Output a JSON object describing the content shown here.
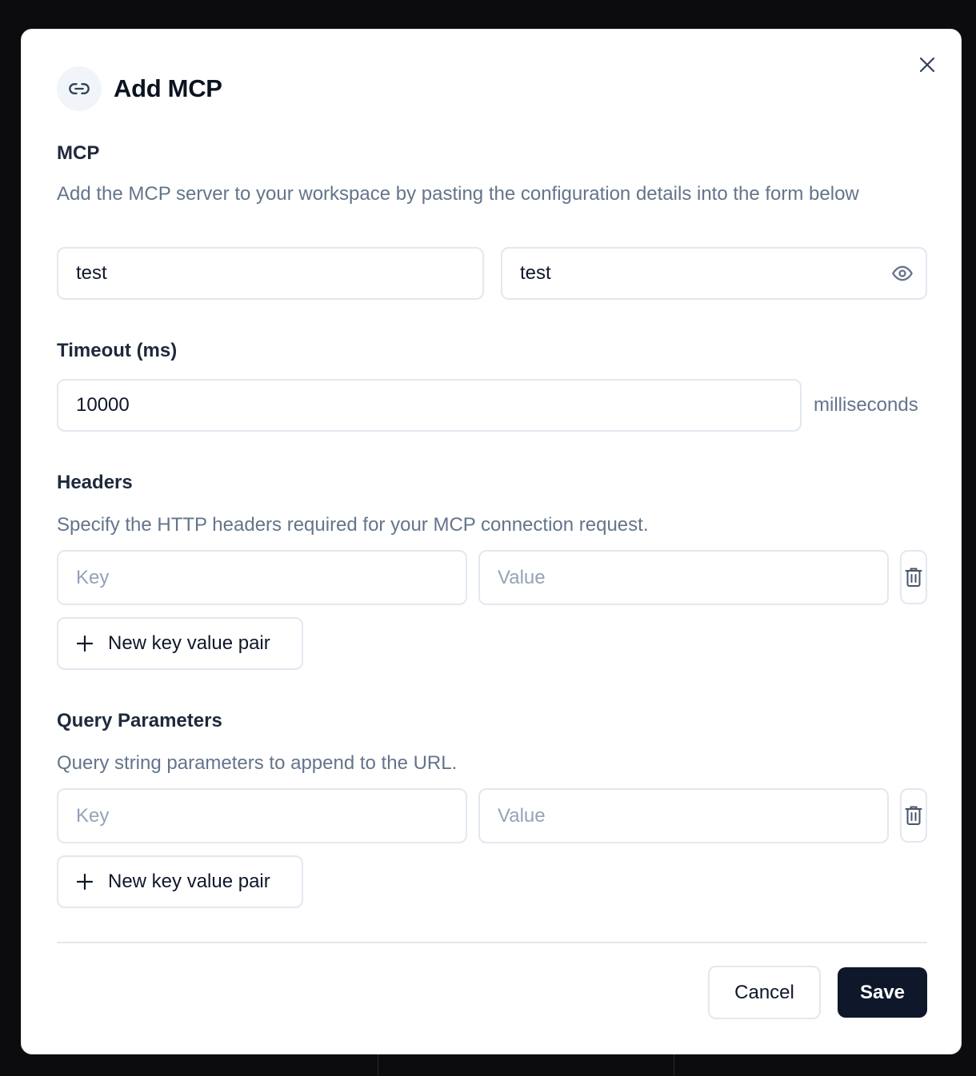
{
  "dialog": {
    "title": "Add MCP",
    "header_icon": "link-icon",
    "close_icon": "close-icon"
  },
  "mcp": {
    "label": "MCP",
    "description": "Add the MCP server to your workspace by pasting the configuration details into the form below",
    "name_value": "test",
    "secret_value": "test",
    "secret_toggle_icon": "eye-icon"
  },
  "timeout": {
    "label": "Timeout (ms)",
    "value": "10000",
    "unit": "milliseconds"
  },
  "headers": {
    "label": "Headers",
    "description": "Specify the HTTP headers required for your MCP connection request.",
    "key_placeholder": "Key",
    "value_placeholder": "Value",
    "delete_icon": "trash-icon",
    "add_label": "New key value pair",
    "add_icon": "plus-icon"
  },
  "query_params": {
    "label": "Query Parameters",
    "description": "Query string parameters to append to the URL.",
    "key_placeholder": "Key",
    "value_placeholder": "Value",
    "delete_icon": "trash-icon",
    "add_label": "New key value pair",
    "add_icon": "plus-icon"
  },
  "footer": {
    "cancel_label": "Cancel",
    "save_label": "Save"
  },
  "colors": {
    "primary": "#0f172a",
    "muted_text": "#64748b",
    "border": "#e2e8f0",
    "overlay": "#0c0c0e"
  }
}
